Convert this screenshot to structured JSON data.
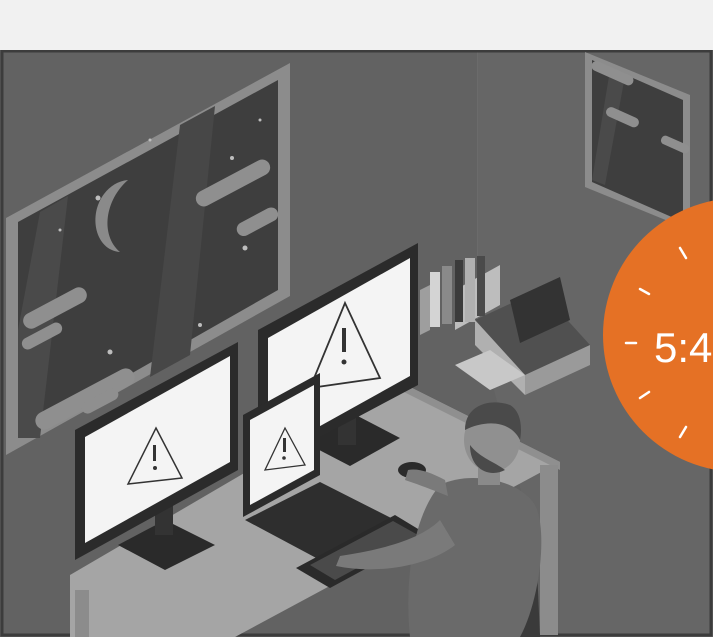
{
  "scene": {
    "clock": {
      "time_text": "5:4",
      "color": "#e57125"
    },
    "palette": {
      "wall": "#626262",
      "window_frame": "#8e8e8e",
      "night_sky": "#3d3d3d",
      "screen": "#f4f4f4",
      "monitor_body": "#2b2b2b",
      "desk": "#a3a3a3"
    }
  }
}
